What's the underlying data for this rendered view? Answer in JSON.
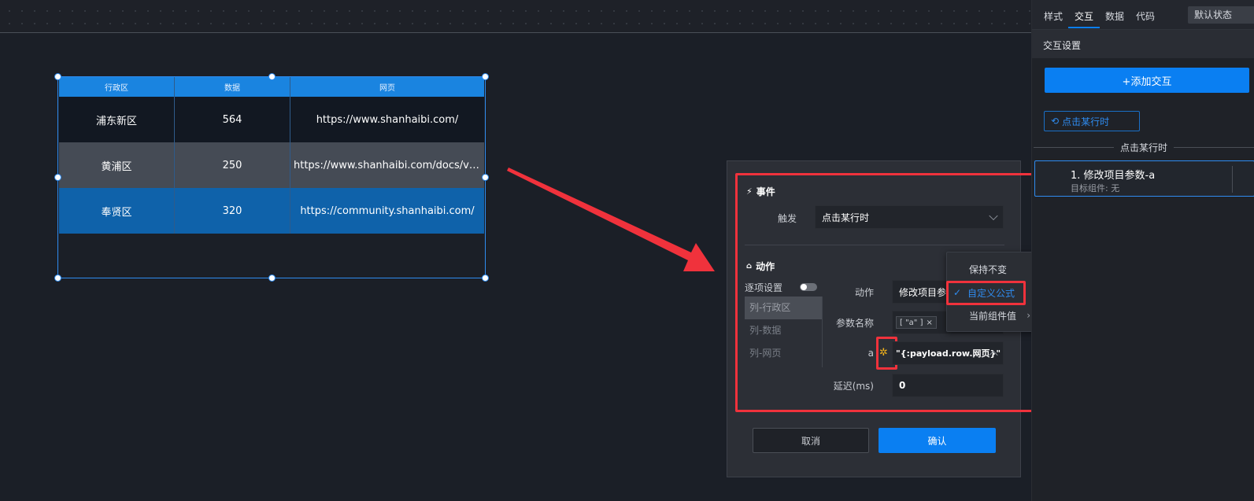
{
  "table": {
    "headers": [
      "行政区",
      "数据",
      "网页"
    ],
    "rows": [
      [
        "浦东新区",
        "564",
        "https://www.shanhaibi.com/"
      ],
      [
        "黄浦区",
        "250",
        "https://www.shanhaibi.com/docs/v1/dg..."
      ],
      [
        "奉贤区",
        "320",
        "https://community.shanhaibi.com/"
      ]
    ]
  },
  "modal": {
    "event_title": "事件",
    "trigger_label": "触发",
    "trigger_value": "点击某行时",
    "action_title": "动作",
    "per_item_label": "逐项设置",
    "columns": [
      "列-行政区",
      "列-数据",
      "列-网页"
    ],
    "action_label": "动作",
    "action_value": "修改项目参",
    "param_name_label": "参数名称",
    "param_tag": "[ \"a\" ]",
    "param_a_label": "a",
    "param_a_value": "\"{:payload.row.网页}\"",
    "delay_label": "延迟(ms)",
    "delay_value": "0",
    "cancel_label": "取消",
    "confirm_label": "确认"
  },
  "popover": {
    "items": [
      "保持不变",
      "自定义公式",
      "当前组件值"
    ],
    "selected_index": 1
  },
  "right_panel": {
    "tabs": [
      "样式",
      "交互",
      "数据",
      "代码"
    ],
    "active_tab": "交互",
    "state_button": "默认状态",
    "section_title": "交互设置",
    "add_button": "+添加交互",
    "event_chip": "点击某行时",
    "event_separator": "点击某行时",
    "action_card_title": "1. 修改项目参数-a",
    "action_card_subtitle": "目标组件: 无"
  },
  "colors": {
    "accent": "#0a7ff2",
    "highlight_red": "#f0323c",
    "header_blue": "#1a84e0"
  }
}
